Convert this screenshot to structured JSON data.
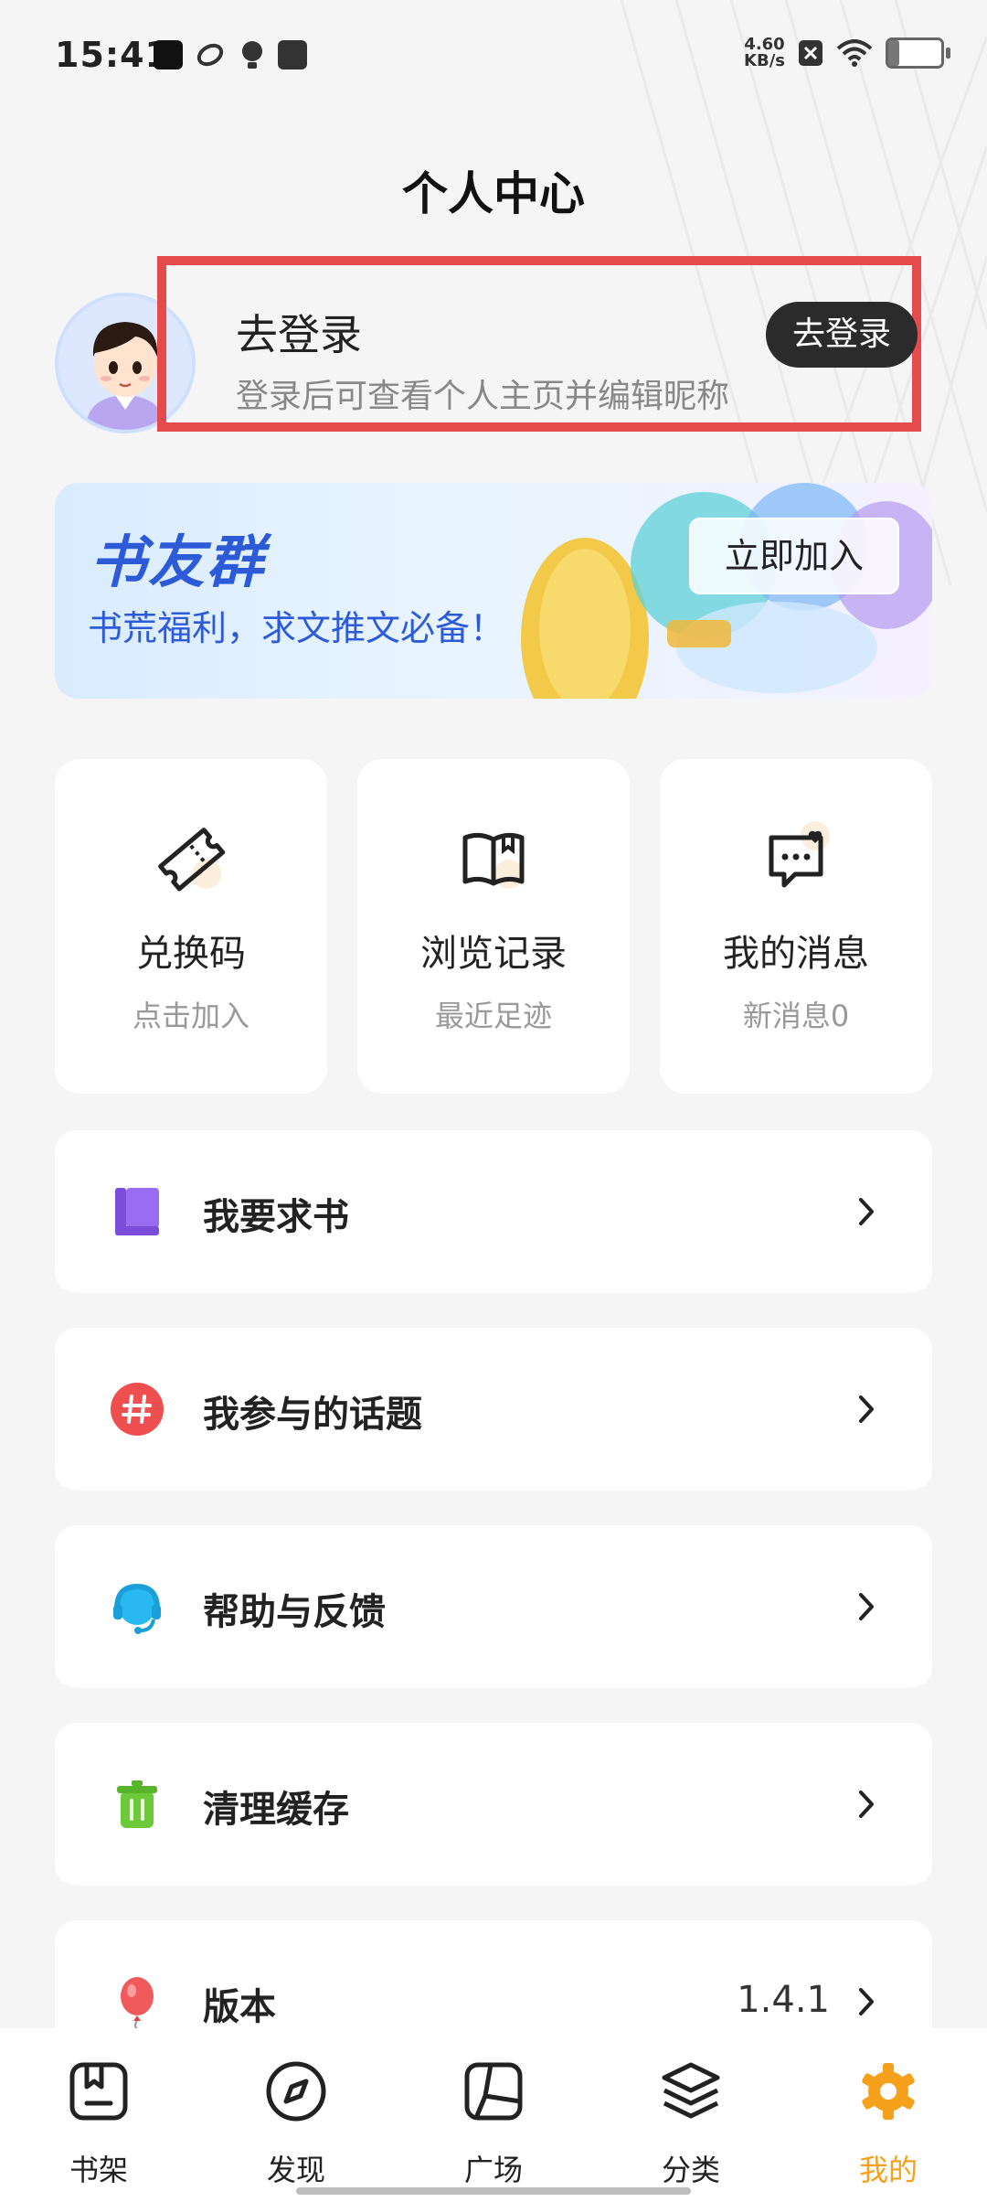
{
  "status_bar": {
    "time": "15:41",
    "net_speed_value": "4.60",
    "net_speed_unit": "KB/s",
    "battery": "21",
    "battery_level": 0.21
  },
  "header": {
    "title": "个人中心"
  },
  "profile": {
    "login_title": "去登录",
    "login_subtitle": "登录后可查看个人主页并编辑昵称",
    "login_button": "去登录"
  },
  "banner": {
    "title": "书友群",
    "subtitle": "书荒福利，求文推文必备！",
    "join_button": "立即加入"
  },
  "quick_cards": [
    {
      "label": "兑换码",
      "sub": "点击加入",
      "icon": "ticket-icon"
    },
    {
      "label": "浏览记录",
      "sub": "最近足迹",
      "icon": "book-open-icon"
    },
    {
      "label": "我的消息",
      "sub": "新消息0",
      "icon": "message-icon"
    }
  ],
  "menu": [
    {
      "label": "我要求书",
      "icon": "book-request-icon",
      "color": "#8b5cf6"
    },
    {
      "label": "我参与的话题",
      "icon": "hashtag-icon",
      "color": "#ef4444"
    },
    {
      "label": "帮助与反馈",
      "icon": "headset-icon",
      "color": "#1fb6f0"
    },
    {
      "label": "清理缓存",
      "icon": "trash-icon",
      "color": "#6cc93a"
    },
    {
      "label": "版本",
      "value": "1.4.1",
      "icon": "balloon-icon",
      "color": "#f05a5a"
    }
  ],
  "tabs": [
    {
      "label": "书架",
      "icon": "bookshelf-icon"
    },
    {
      "label": "发现",
      "icon": "compass-icon"
    },
    {
      "label": "广场",
      "icon": "square-icon"
    },
    {
      "label": "分类",
      "icon": "layers-icon"
    },
    {
      "label": "我的",
      "icon": "gear-icon",
      "active": true
    }
  ],
  "colors": {
    "accent": "#f5a11c",
    "highlight": "#e64b4b",
    "banner_text": "#2d5bd8"
  }
}
